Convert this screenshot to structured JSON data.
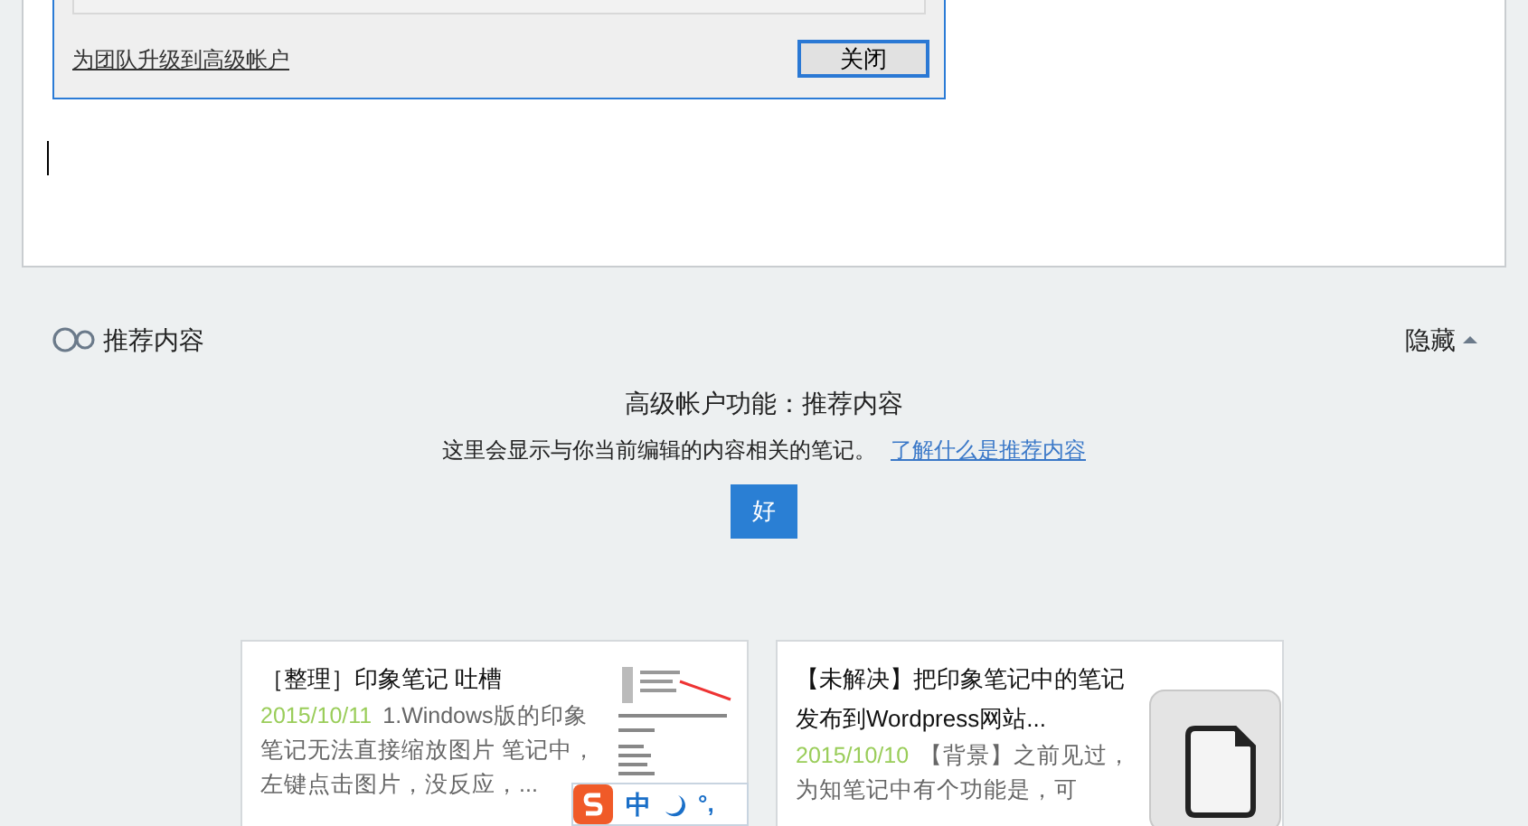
{
  "dialog": {
    "upgrade_link": "为团队升级到高级帐户",
    "close_button": "关闭"
  },
  "recommend": {
    "title": "推荐内容",
    "hide": "隐藏",
    "expanded": true,
    "heading": "高级帐户功能：推荐内容",
    "description": "这里会显示与你当前编辑的内容相关的笔记。",
    "learn_link": "了解什么是推荐内容",
    "ok_button": "好"
  },
  "cards": [
    {
      "kind": "document",
      "title": "［整理］印象笔记 吐槽",
      "date": "2015/10/11",
      "snippet": "1.Windows版的印象笔记无法直接缩放图片 笔记中，左键点击图片，没反应，..."
    },
    {
      "kind": "file",
      "title": "【未解决】把印象笔记中的笔记发布到Wordpress网站...",
      "date": "2015/10/10",
      "snippet": "【背景】之前见过，为知笔记中有个功能是，可"
    }
  ],
  "ime": {
    "mode": "中",
    "punctuation": "°,"
  }
}
